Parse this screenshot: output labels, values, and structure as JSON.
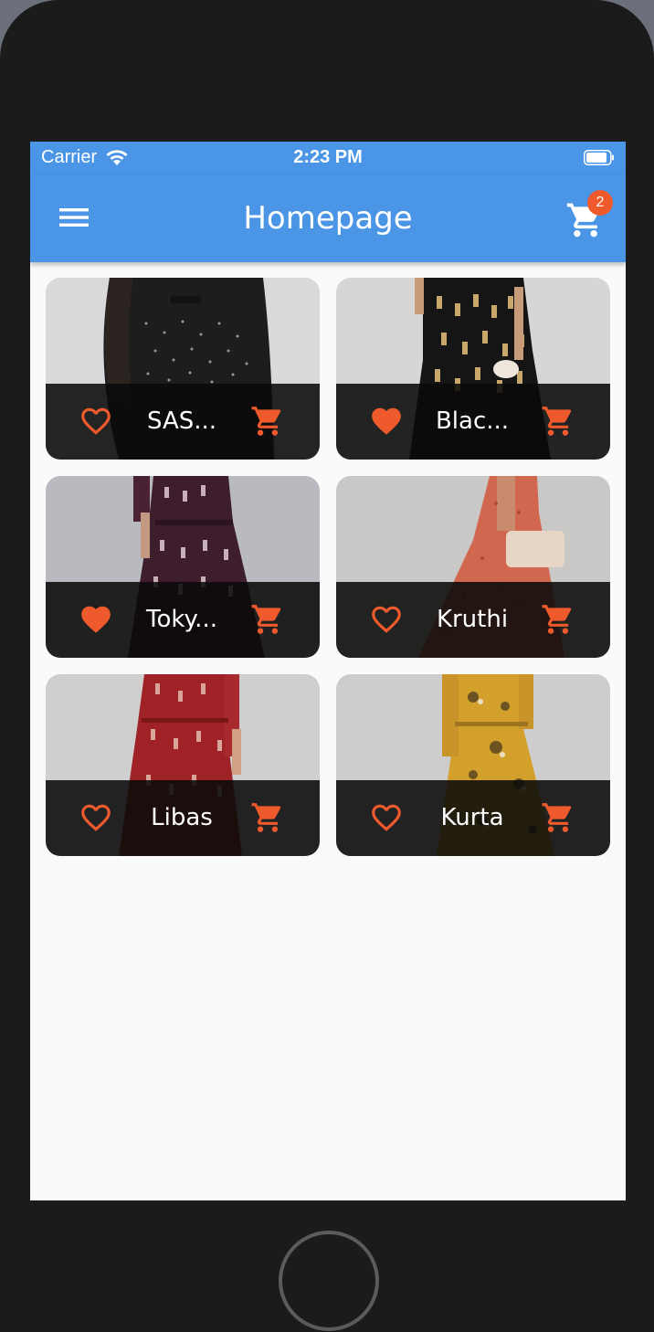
{
  "status_bar": {
    "carrier": "Carrier",
    "time": "2:23 PM"
  },
  "app_bar": {
    "title": "Homepage",
    "cart_count": "2"
  },
  "colors": {
    "primary": "#4a95e6",
    "accent": "#ee5a2c",
    "footer_overlay": "#0a0a0a"
  },
  "products": [
    {
      "name": "SAS...",
      "favorited": false,
      "photo": "dress-black-polka-dot"
    },
    {
      "name": "Blac...",
      "favorited": true,
      "photo": "dress-black-gold-print"
    },
    {
      "name": "Toky...",
      "favorited": true,
      "photo": "dress-purple-print"
    },
    {
      "name": "Kruthi",
      "favorited": false,
      "photo": "dress-coral-print"
    },
    {
      "name": "Libas",
      "favorited": false,
      "photo": "dress-red-print"
    },
    {
      "name": "Kurta",
      "favorited": false,
      "photo": "dress-mustard-floral"
    }
  ],
  "icons": {
    "menu": "menu-icon",
    "cart": "shopping-cart-icon",
    "favorite": "heart-icon",
    "wifi": "wifi-icon",
    "battery": "battery-icon"
  }
}
